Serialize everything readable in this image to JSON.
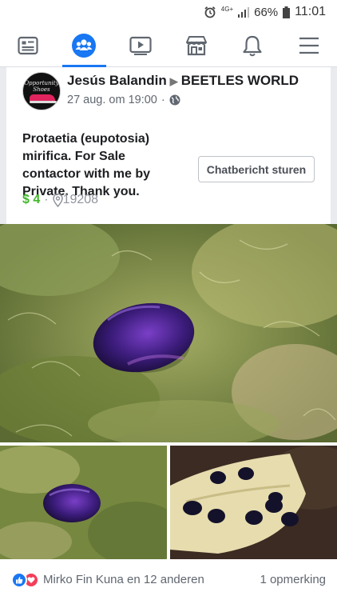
{
  "status_bar": {
    "network": "4G+",
    "battery": "66%",
    "time": "11:01"
  },
  "nav": {
    "tabs": [
      {
        "icon": "news-feed-icon",
        "active": false
      },
      {
        "icon": "groups-icon",
        "active": true
      },
      {
        "icon": "watch-icon",
        "active": false
      },
      {
        "icon": "marketplace-icon",
        "active": false
      },
      {
        "icon": "notifications-bell-icon",
        "active": false
      },
      {
        "icon": "menu-icon",
        "active": false
      }
    ]
  },
  "post": {
    "avatar_text": "Opportunity Shoes",
    "author": "Jesús Balandin",
    "group": "BEETLES WORLD",
    "date": "27 aug. om 19:00",
    "title": "Protaetia (eupotosia) mirifica. For Sale contactor with me by Private.  Thank you.",
    "price": "$ 4",
    "zip": "19208",
    "chat_button": "Chatbericht sturen"
  },
  "footer": {
    "reactions_text": "Mirko Fin Kuna en 12 anderen",
    "comments": "1 opmerking"
  },
  "colors": {
    "accent": "#1877f2",
    "price_green": "#42b72a",
    "love_red": "#f33e58"
  }
}
